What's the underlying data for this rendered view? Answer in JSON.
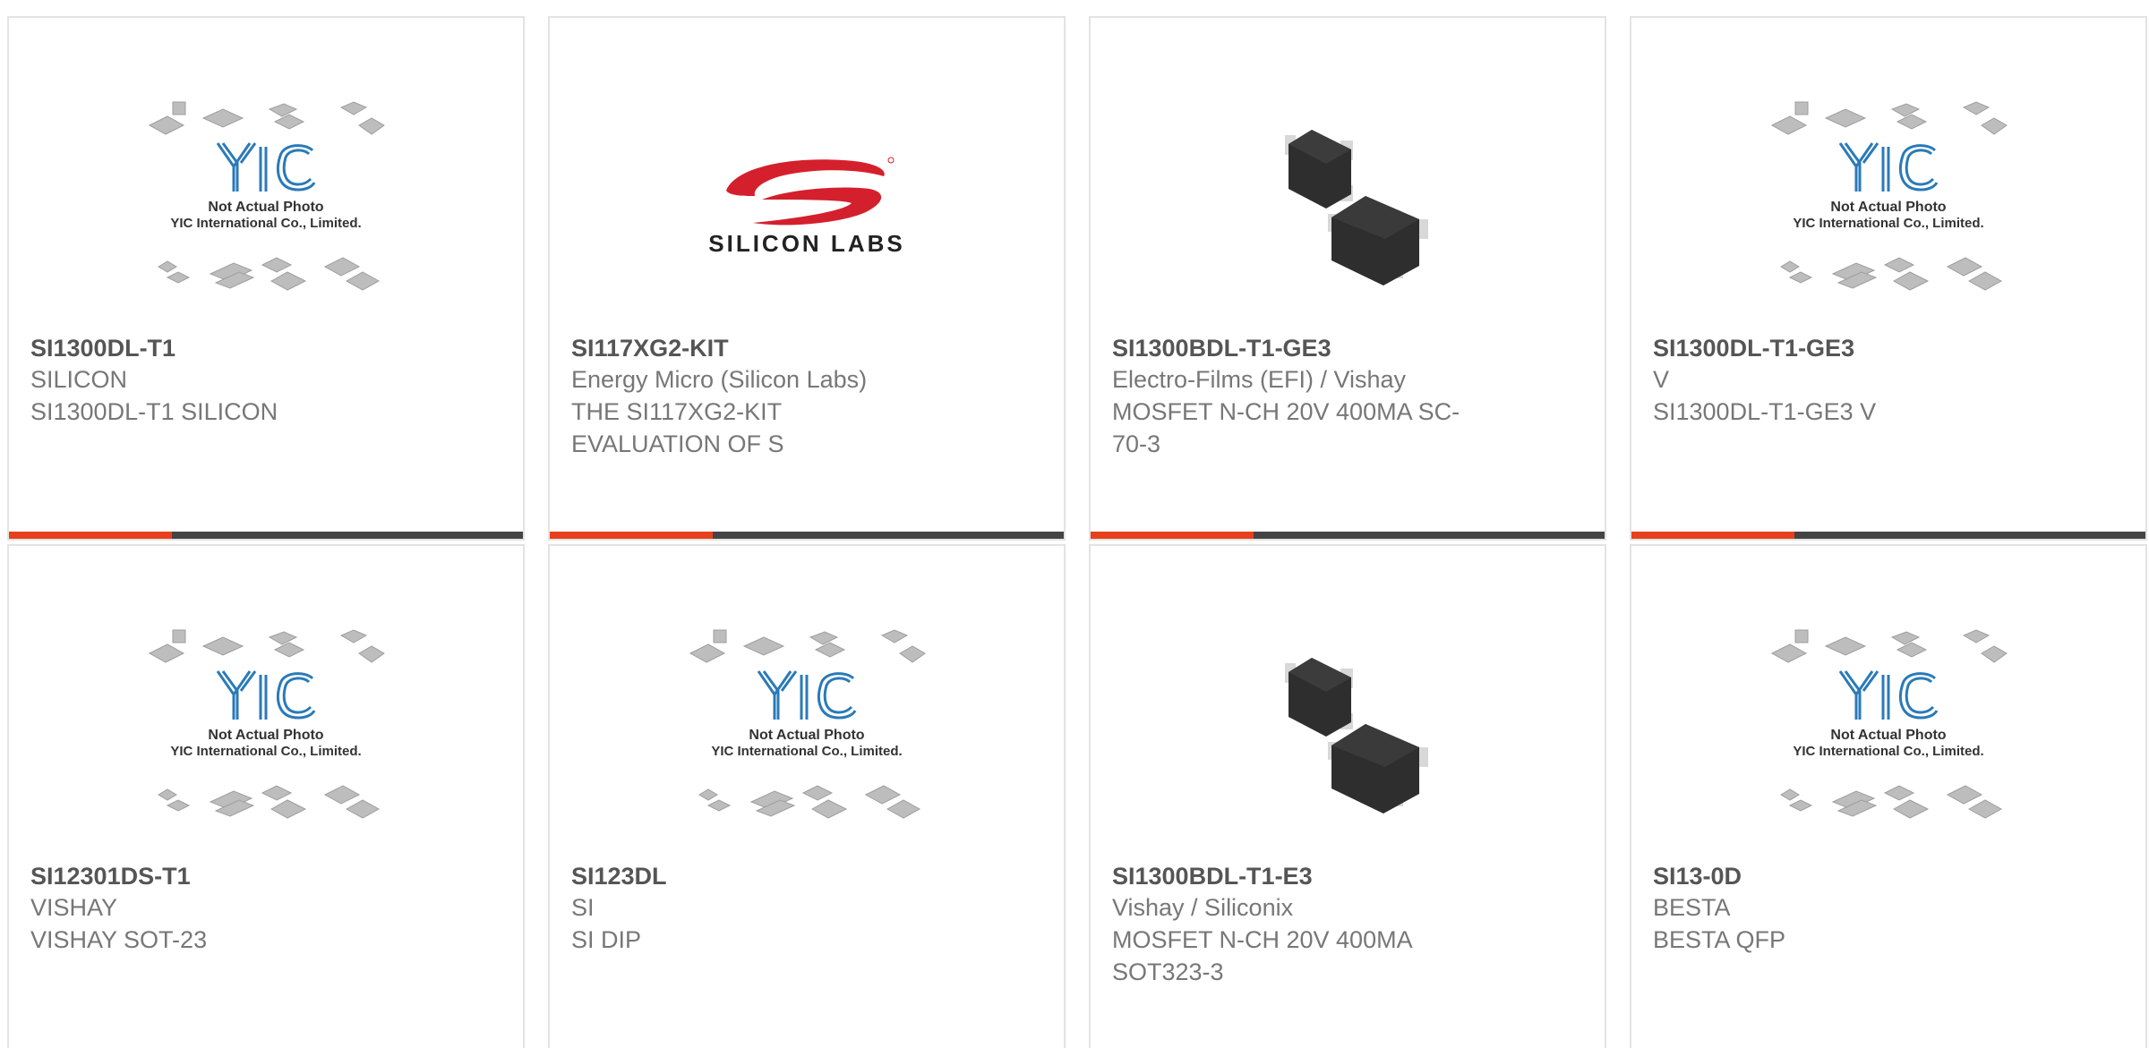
{
  "colors": {
    "accent": "#e8401c",
    "bar_dark": "#444444",
    "card_border": "#e3e3e3",
    "part_number": "#555555",
    "secondary_text": "#777777",
    "yic_logo_blue": "#2a7ab8",
    "silicon_labs_red": "#d4202c"
  },
  "placeholder": {
    "caption_line1": "Not Actual Photo",
    "caption_line2": "YIC International Co., Limited."
  },
  "silicon_labs_logo": {
    "wordmark": "SILICON LABS"
  },
  "products": [
    {
      "part_number": "SI1300DL-T1",
      "manufacturer": "SILICON",
      "description_lines": [
        "SI1300DL-T1 SILICON"
      ],
      "image": "yic-placeholder"
    },
    {
      "part_number": "SI117XG2-KIT",
      "manufacturer": "Energy Micro (Silicon Labs)",
      "description_lines": [
        "THE SI117XG2-KIT",
        "EVALUATION OF S"
      ],
      "image": "silicon-labs-logo"
    },
    {
      "part_number": "SI1300BDL-T1-GE3",
      "manufacturer": "Electro-Films (EFI) / Vishay",
      "description_lines": [
        "MOSFET N-CH 20V 400MA SC-",
        "70-3"
      ],
      "image": "sot-package-photo"
    },
    {
      "part_number": "SI1300DL-T1-GE3",
      "manufacturer": "V",
      "description_lines": [
        "SI1300DL-T1-GE3 V"
      ],
      "image": "yic-placeholder"
    },
    {
      "part_number": "SI12301DS-T1",
      "manufacturer": "VISHAY",
      "description_lines": [
        "VISHAY SOT-23"
      ],
      "image": "yic-placeholder"
    },
    {
      "part_number": "SI123DL",
      "manufacturer": "SI",
      "description_lines": [
        "SI DIP"
      ],
      "image": "yic-placeholder"
    },
    {
      "part_number": "SI1300BDL-T1-E3",
      "manufacturer": "Vishay / Siliconix",
      "description_lines": [
        "MOSFET N-CH 20V 400MA",
        "SOT323-3"
      ],
      "image": "sot-package-photo"
    },
    {
      "part_number": "SI13-0D",
      "manufacturer": "BESTA",
      "description_lines": [
        "BESTA QFP"
      ],
      "image": "yic-placeholder"
    }
  ]
}
